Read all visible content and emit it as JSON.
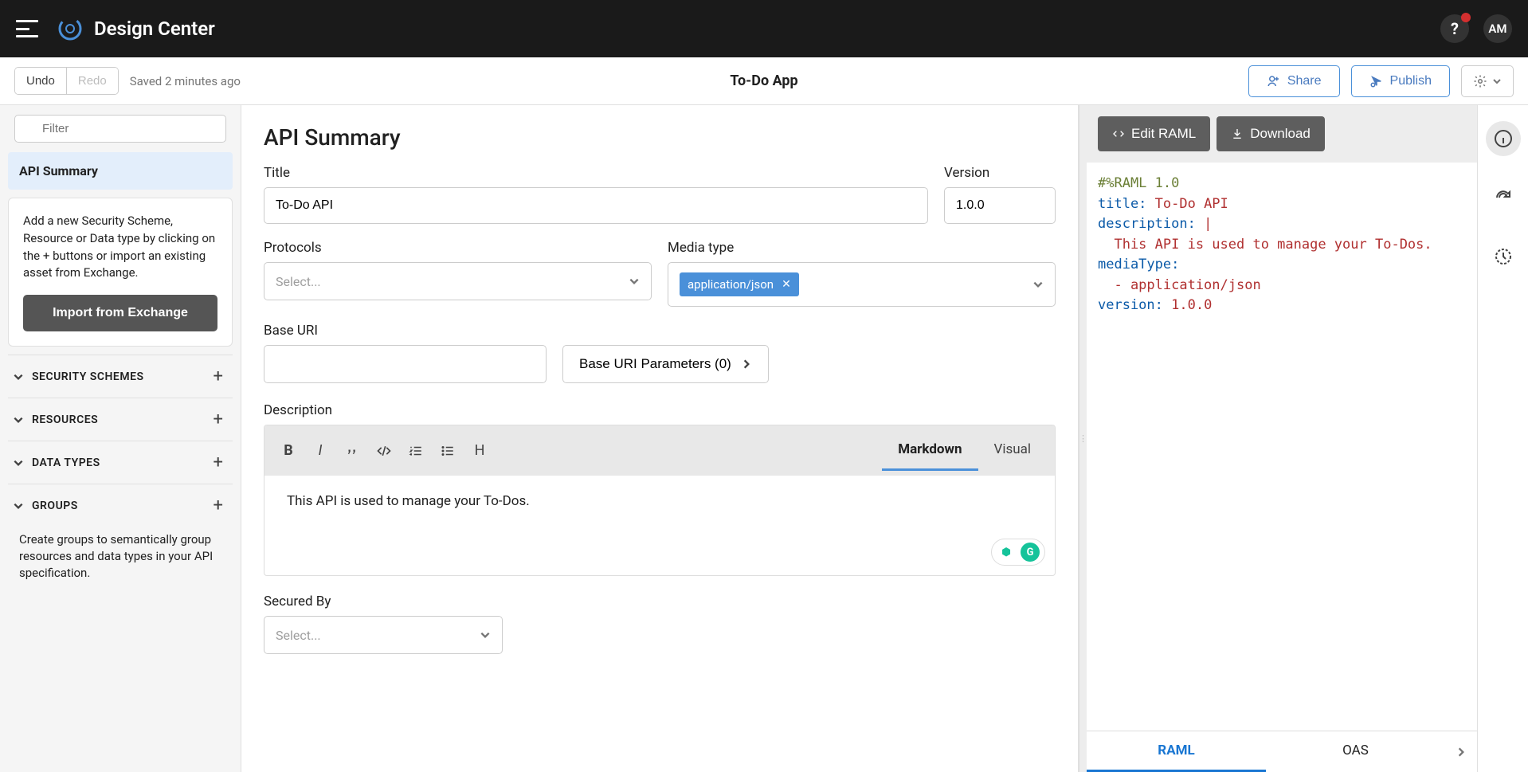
{
  "app": {
    "title": "Design Center"
  },
  "user": {
    "initials": "AM"
  },
  "toolbar": {
    "undo": "Undo",
    "redo": "Redo",
    "saved": "Saved 2 minutes ago",
    "doc_title": "To-Do App",
    "share": "Share",
    "publish": "Publish"
  },
  "sidebar": {
    "filter_placeholder": "Filter",
    "nav_summary": "API Summary",
    "card_text": "Add a new Security Scheme, Resource or Data type by clicking on the + buttons or import an existing asset from Exchange.",
    "import_btn": "Import from Exchange",
    "sections": {
      "security": "SECURITY SCHEMES",
      "resources": "RESOURCES",
      "datatypes": "DATA TYPES",
      "groups": "GROUPS"
    },
    "groups_note": "Create groups to semantically group resources and data types in your API specification."
  },
  "form": {
    "heading": "API Summary",
    "title_label": "Title",
    "title_value": "To-Do API",
    "version_label": "Version",
    "version_value": "1.0.0",
    "protocols_label": "Protocols",
    "protocols_placeholder": "Select...",
    "media_label": "Media type",
    "media_chip": "application/json",
    "baseuri_label": "Base URI",
    "baseuri_value": "",
    "params_btn": "Base URI Parameters (0)",
    "desc_label": "Description",
    "desc_value": "This API is used to manage your To-Dos.",
    "tab_markdown": "Markdown",
    "tab_visual": "Visual",
    "secured_label": "Secured By",
    "secured_placeholder": "Select..."
  },
  "right": {
    "edit_btn": "Edit RAML",
    "download_btn": "Download",
    "tab_raml": "RAML",
    "tab_oas": "OAS",
    "code": {
      "l1": "#%RAML 1.0",
      "l2k": "title:",
      "l2v": " To-Do API",
      "l3k": "description:",
      "l3v": " |",
      "l4": "  This API is used to manage your To-Dos.",
      "l5k": "mediaType:",
      "l6": "  - application/json",
      "l7k": "version:",
      "l7v": " 1.0.0"
    }
  }
}
